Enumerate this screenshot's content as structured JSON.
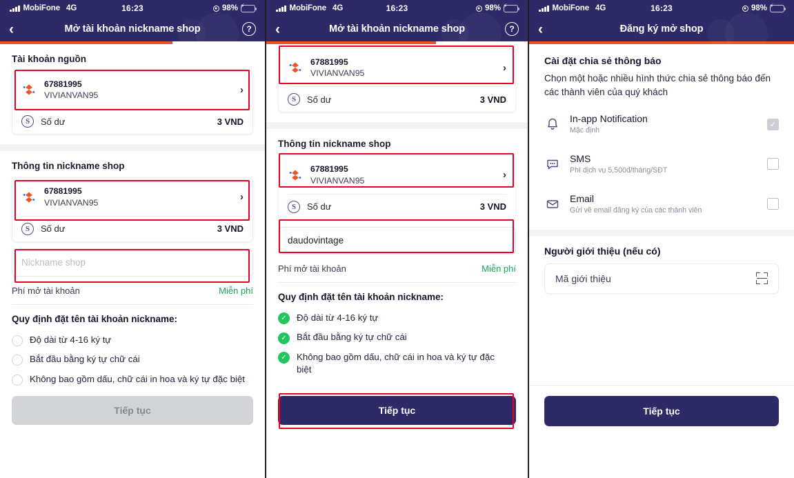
{
  "status_bar": {
    "carrier": "MobiFone",
    "network": "4G",
    "time": "16:23",
    "battery_pct": "98%",
    "signal_icon": "signal-bars-icon",
    "battery_icon": "battery-charging-icon",
    "location_icon": "location-services-icon"
  },
  "panel1": {
    "nav": {
      "title": "Mở tài khoản nickname shop",
      "back_icon": "back-chevron-icon",
      "help_icon": "help-circle-icon"
    },
    "progress_pct": 65,
    "source_section_title": "Tài khoản nguồn",
    "source_account": {
      "number": "67881995",
      "name": "VIVIANVAN95",
      "icon": "shb-account-icon",
      "chevron": "›"
    },
    "source_balance": {
      "label": "Số dư",
      "value": "3 VND",
      "icon": "balance-coin-icon"
    },
    "info_section_title": "Thông tin nickname shop",
    "info_account": {
      "number": "67881995",
      "name": "VIVIANVAN95",
      "icon": "shb-account-icon",
      "chevron": "›"
    },
    "info_balance": {
      "label": "Số dư",
      "value": "3 VND",
      "icon": "balance-coin-icon"
    },
    "nickname_placeholder": "Nickname shop",
    "nickname_value": "",
    "fee": {
      "label": "Phí mở tài khoản",
      "value": "Miễn phí"
    },
    "rules_title": "Quy định đặt tên tài khoản nickname:",
    "rules": [
      {
        "text": "Độ dài từ 4-16 ký tự",
        "state": "unchecked"
      },
      {
        "text": "Bắt đầu bằng ký tự chữ cái",
        "state": "unchecked"
      },
      {
        "text": "Không bao gồm dấu, chữ cái in hoa và ký tự đặc biệt",
        "state": "unchecked"
      }
    ],
    "cta": {
      "label": "Tiếp tục",
      "enabled": false
    }
  },
  "panel2": {
    "nav": {
      "title": "Mở tài khoản nickname shop",
      "back_icon": "back-chevron-icon",
      "help_icon": "help-circle-icon"
    },
    "progress_pct": 65,
    "source_account": {
      "number": "67881995",
      "name": "VIVIANVAN95",
      "icon": "shb-account-icon",
      "chevron": "›"
    },
    "source_balance": {
      "label": "Số dư",
      "value": "3 VND",
      "icon": "balance-coin-icon"
    },
    "info_section_title": "Thông tin nickname shop",
    "info_account": {
      "number": "67881995",
      "name": "VIVIANVAN95",
      "icon": "shb-account-icon",
      "chevron": "›"
    },
    "info_balance": {
      "label": "Số dư",
      "value": "3 VND",
      "icon": "balance-coin-icon"
    },
    "nickname_value": "daudovintage",
    "nickname_placeholder": "Nickname shop",
    "fee": {
      "label": "Phí mở tài khoản",
      "value": "Miễn phí"
    },
    "rules_title": "Quy định đặt tên tài khoản nickname:",
    "rules": [
      {
        "text": "Độ dài từ 4-16 ký tự",
        "state": "checked"
      },
      {
        "text": "Bắt đầu bằng ký tự chữ cái",
        "state": "checked"
      },
      {
        "text": "Không bao gồm dấu, chữ cái in hoa và ký tự đặc biệt",
        "state": "checked"
      }
    ],
    "cta": {
      "label": "Tiếp tục",
      "enabled": true
    }
  },
  "panel3": {
    "nav": {
      "title": "Đăng ký mở shop",
      "back_icon": "back-chevron-icon"
    },
    "progress_pct": 100,
    "section_title": "Cài đặt chia sẻ thông báo",
    "section_desc": "Chọn một hoặc nhiều hình thức chia sẻ thông báo đến các thành viên của quý khách",
    "channels": [
      {
        "icon": "bell-icon",
        "title": "In-app Notification",
        "subtitle": "Mặc định",
        "checked": true,
        "disabled": true
      },
      {
        "icon": "sms-bubble-icon",
        "title": "SMS",
        "subtitle": "Phí dịch vụ 5,500đ/tháng/SĐT",
        "checked": false,
        "disabled": false
      },
      {
        "icon": "envelope-icon",
        "title": "Email",
        "subtitle": "Gửi về email đăng ký của các thành viên",
        "checked": false,
        "disabled": false
      }
    ],
    "referrer_title": "Người giới thiệu (nếu có)",
    "referrer_placeholder": "Mã giới thiệu",
    "referrer_value": "",
    "scan_icon": "qr-scan-icon",
    "cta": {
      "label": "Tiếp tục",
      "enabled": true
    }
  },
  "colors": {
    "nav_bg": "#2e2a68",
    "progress": "#e8562a",
    "highlight": "#e60023",
    "success": "#22c55e",
    "fee_free": "#18a558",
    "cta_active": "#2e2a68",
    "cta_disabled": "#d3d4d7"
  }
}
